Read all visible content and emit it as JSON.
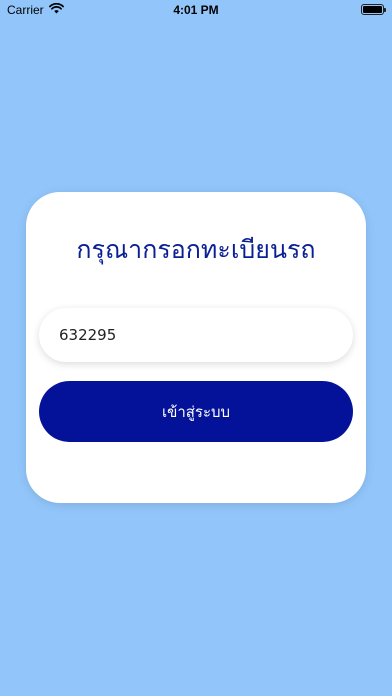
{
  "status_bar": {
    "carrier": "Carrier",
    "time": "4:01 PM",
    "icons": [
      "wifi-icon",
      "battery-icon"
    ]
  },
  "login_card": {
    "title": "กรุณากรอกทะเบียนรถ",
    "plate_input": {
      "value": "632295",
      "placeholder": ""
    },
    "login_button_label": "เข้าสู่ระบบ"
  },
  "colors": {
    "background": "#92c6fb",
    "title": "#0a1f96",
    "button": "#04129a",
    "card": "#ffffff"
  }
}
